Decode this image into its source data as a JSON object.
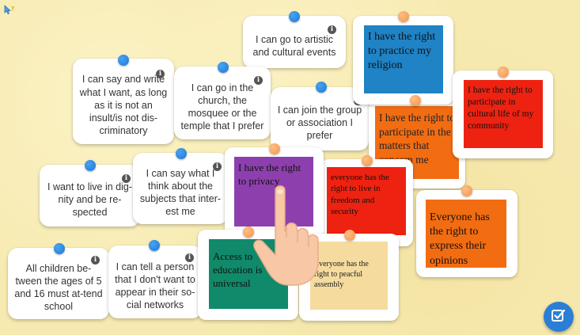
{
  "colors": {
    "background": "#f7eab0",
    "pin_blue": "#1c78d6",
    "pin_orange": "#f0954a",
    "square_blue": "#1f83c5",
    "square_red": "#ee2211",
    "square_orange": "#f26c12",
    "square_purple": "#8e3fae",
    "square_green": "#108a6a",
    "square_beige": "#f5dc9e",
    "check_button": "#2a7fd4"
  },
  "corner_icon": "help-cursor-icon",
  "statement_cards": [
    {
      "id": "artistic",
      "text": "I can go to artistic and cultural events"
    },
    {
      "id": "write",
      "text": "I can say and write what I want, as long as it is not an insult/is not dis-criminatory"
    },
    {
      "id": "church",
      "text": "I can go in the church, the mosquee or the temple that I prefer"
    },
    {
      "id": "group",
      "text": "I can join the group or association I prefer"
    },
    {
      "id": "dignity",
      "text": "I want to live in dig-nity and be re-spected"
    },
    {
      "id": "say-think",
      "text": "I can say what I think about the subjects that inter-est me"
    },
    {
      "id": "school",
      "text": "All children be-tween the ages of 5 and 16 must at-tend school"
    },
    {
      "id": "tell-person",
      "text": "I can tell a person that I don't want to appear in their so-cial networks"
    }
  ],
  "right_cards": [
    {
      "id": "religion",
      "text": "I have the right to practice my religion"
    },
    {
      "id": "cultural-life",
      "text": "I have the right to participate in cultural life of my community"
    },
    {
      "id": "matters",
      "text": "I have the right to participate in the matters that concern me"
    },
    {
      "id": "privacy",
      "text": "I have the right to privacy"
    },
    {
      "id": "live-freedom",
      "text": "everyone has the right to live in freedom and security"
    },
    {
      "id": "express",
      "text": "Everyone has the right to express their opinions"
    },
    {
      "id": "education",
      "text": "Access to education is universal"
    },
    {
      "id": "assembly",
      "text": "Everyone has the right to peacful assembly"
    }
  ],
  "info_glyph": "i",
  "check_button_icon": "check-edit-icon",
  "hand_icon": "pointing-hand-icon"
}
